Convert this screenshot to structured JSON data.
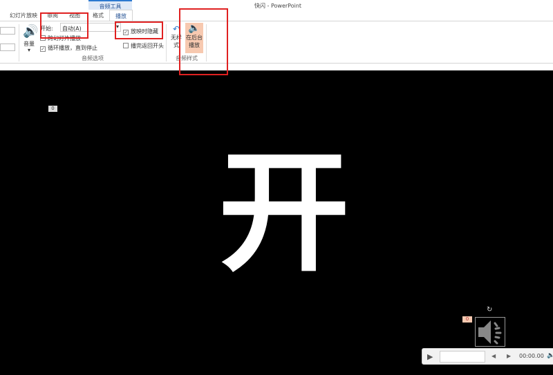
{
  "window": {
    "title": "快闪 - PowerPoint"
  },
  "ribbon": {
    "contextual_tab": "音频工具",
    "tabs": [
      {
        "label": "幻灯片放映"
      },
      {
        "label": "审阅"
      },
      {
        "label": "视图"
      },
      {
        "label": "格式"
      },
      {
        "label": "播放"
      }
    ],
    "active_tab": "播放",
    "volume_label": "音量",
    "start_label": "开始:",
    "start_value": "自动(A)",
    "play_across_slides": {
      "label": "跨幻灯片播放",
      "checked": false
    },
    "loop": {
      "label": "循环播放，直到停止",
      "checked": true
    },
    "hide_during_show": {
      "label": "放映时隐藏",
      "checked": true
    },
    "rewind": {
      "label": "播完返回开头",
      "checked": false
    },
    "audio_options_group": "音频选项",
    "no_style_label": "无样式",
    "play_in_background_label": "在后台播放",
    "audio_styles_group": "音频样式"
  },
  "slide": {
    "main_text": "开",
    "badge_top": "0",
    "badge_audio": "0"
  },
  "player": {
    "time": "00:00.00"
  },
  "colors": {
    "highlight": "#e02020",
    "active_button": "#f7c9b0"
  }
}
